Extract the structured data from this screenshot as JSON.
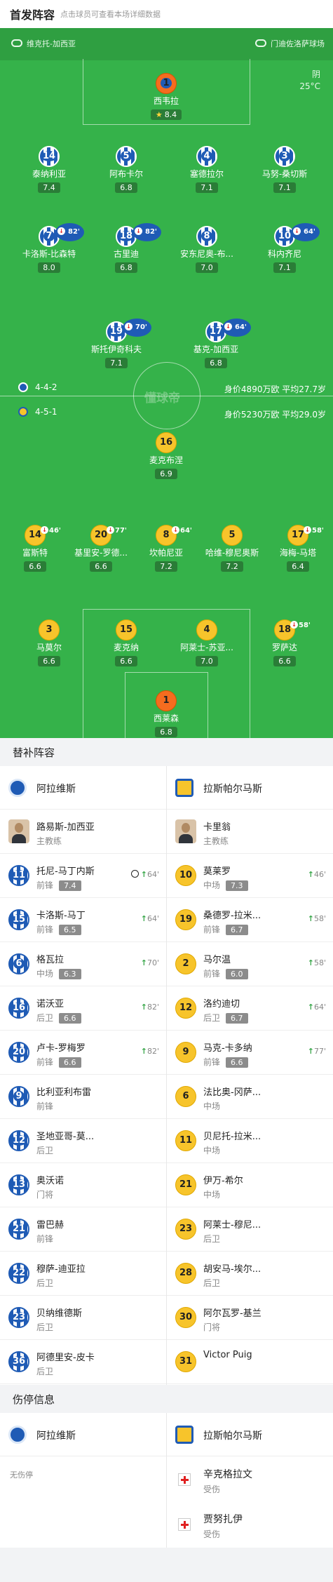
{
  "header": {
    "title": "首发阵容",
    "subtitle": "点击球员可查看本场详细数据"
  },
  "pitch": {
    "home_team": "维克托-加西亚",
    "away_team": "门迪佐洛萨球场",
    "weather": "阴",
    "temperature": "25°C",
    "watermark": "懂球帝",
    "home_formation": "4-4-2",
    "home_value": "身价4890万欧 平均27.7岁",
    "away_formation": "4-5-1",
    "away_value": "身价5230万欧 平均29.0岁"
  },
  "home_players": [
    {
      "num": "1",
      "name": "西韦拉",
      "rating": "8.4",
      "star": true
    },
    {
      "num": "14",
      "name": "泰纳利亚",
      "rating": "7.4"
    },
    {
      "num": "5",
      "name": "阿布卡尔",
      "rating": "6.8"
    },
    {
      "num": "4",
      "name": "塞德拉尔",
      "rating": "7.1"
    },
    {
      "num": "3",
      "name": "马努-桑切斯",
      "rating": "7.1"
    },
    {
      "num": "7",
      "name": "卡洛斯-比森特",
      "rating": "8.0",
      "sub_min": "82'"
    },
    {
      "num": "18",
      "name": "古里迪",
      "rating": "6.8",
      "sub_min": "82'"
    },
    {
      "num": "8",
      "name": "安东尼奥-布...",
      "rating": "7.0"
    },
    {
      "num": "10",
      "name": "科内齐尼",
      "rating": "7.1",
      "sub_min": "64'"
    },
    {
      "num": "19",
      "name": "斯托伊奇科夫",
      "rating": "7.1",
      "sub_min": "70'"
    },
    {
      "num": "17",
      "name": "基克-加西亚",
      "rating": "6.8",
      "sub_min": "64'"
    }
  ],
  "away_players": [
    {
      "num": "16",
      "name": "麦克布涅",
      "rating": "6.9"
    },
    {
      "num": "14",
      "name": "富斯特",
      "rating": "6.6",
      "sub_min": "46'"
    },
    {
      "num": "20",
      "name": "基里安-罗德...",
      "rating": "6.6",
      "sub_min": "77'"
    },
    {
      "num": "8",
      "name": "坎帕尼亚",
      "rating": "7.2",
      "sub_min": "64'"
    },
    {
      "num": "5",
      "name": "哈维-穆尼奥斯",
      "rating": "7.2"
    },
    {
      "num": "17",
      "name": "海梅-马塔",
      "rating": "6.4",
      "sub_min": "58'"
    },
    {
      "num": "3",
      "name": "马莫尔",
      "rating": "6.6"
    },
    {
      "num": "15",
      "name": "麦克纳",
      "rating": "6.6"
    },
    {
      "num": "4",
      "name": "阿莱士-苏亚...",
      "rating": "7.0"
    },
    {
      "num": "18",
      "name": "罗萨达",
      "rating": "6.6",
      "sub_min": "58'"
    },
    {
      "num": "1",
      "name": "西莱森",
      "rating": "6.8"
    }
  ],
  "subs": {
    "title": "替补阵容",
    "home_team": "阿拉维斯",
    "away_team": "拉斯帕尔马斯",
    "home_coach": {
      "name": "路易斯-加西亚",
      "role": "主教练"
    },
    "away_coach": {
      "name": "卡里翁",
      "role": "主教练"
    },
    "home": [
      {
        "num": "11",
        "name": "托尼-马丁内斯",
        "pos": "前锋",
        "rating": "7.4",
        "min": "64'",
        "goal": true
      },
      {
        "num": "15",
        "name": "卡洛斯-马丁",
        "pos": "前锋",
        "rating": "6.5",
        "min": "64'"
      },
      {
        "num": "6",
        "name": "格瓦拉",
        "pos": "中场",
        "rating": "6.3",
        "min": "70'"
      },
      {
        "num": "16",
        "name": "诺沃亚",
        "pos": "后卫",
        "rating": "6.6",
        "min": "82'"
      },
      {
        "num": "20",
        "name": "卢卡-罗梅罗",
        "pos": "前锋",
        "rating": "6.6",
        "min": "82'"
      },
      {
        "num": "9",
        "name": "比利亚利布雷",
        "pos": "前锋"
      },
      {
        "num": "12",
        "name": "圣地亚哥-莫...",
        "pos": "后卫"
      },
      {
        "num": "13",
        "name": "奥沃诺",
        "pos": "门将"
      },
      {
        "num": "21",
        "name": "雷巴赫",
        "pos": "前锋"
      },
      {
        "num": "22",
        "name": "穆萨-迪亚拉",
        "pos": "后卫"
      },
      {
        "num": "23",
        "name": "贝纳维德斯",
        "pos": "后卫"
      },
      {
        "num": "36",
        "name": "阿德里安-皮卡",
        "pos": "后卫"
      }
    ],
    "away": [
      {
        "num": "10",
        "name": "莫莱罗",
        "pos": "中场",
        "rating": "7.3",
        "min": "46'"
      },
      {
        "num": "19",
        "name": "桑德罗-拉米...",
        "pos": "前锋",
        "rating": "6.7",
        "min": "58'"
      },
      {
        "num": "2",
        "name": "马尔温",
        "pos": "前锋",
        "rating": "6.0",
        "min": "58'"
      },
      {
        "num": "12",
        "name": "洛约迪切",
        "pos": "后卫",
        "rating": "6.7",
        "min": "64'"
      },
      {
        "num": "9",
        "name": "马克-卡多纳",
        "pos": "前锋",
        "rating": "6.6",
        "min": "77'"
      },
      {
        "num": "6",
        "name": "法比奥-冈萨...",
        "pos": "中场"
      },
      {
        "num": "11",
        "name": "贝尼托-拉米...",
        "pos": "中场"
      },
      {
        "num": "21",
        "name": "伊万-希尔",
        "pos": "中场"
      },
      {
        "num": "23",
        "name": "阿莱士-穆尼...",
        "pos": "后卫"
      },
      {
        "num": "28",
        "name": "胡安马-埃尔...",
        "pos": "后卫"
      },
      {
        "num": "30",
        "name": "阿尔瓦罗-基兰",
        "pos": "门将"
      },
      {
        "num": "31",
        "name": "Victor Puig",
        "pos": ""
      }
    ]
  },
  "injuries": {
    "title": "伤停信息",
    "home_team": "阿拉维斯",
    "away_team": "拉斯帕尔马斯",
    "home_none": "无伤停",
    "away": [
      {
        "name": "辛克格拉文",
        "status": "受伤"
      },
      {
        "name": "贾努扎伊",
        "status": "受伤"
      }
    ]
  },
  "colors": {
    "pitch": "#35b24a",
    "home": "#1f5bb5",
    "away": "#f7c42b",
    "gk": "#f56c1f"
  }
}
